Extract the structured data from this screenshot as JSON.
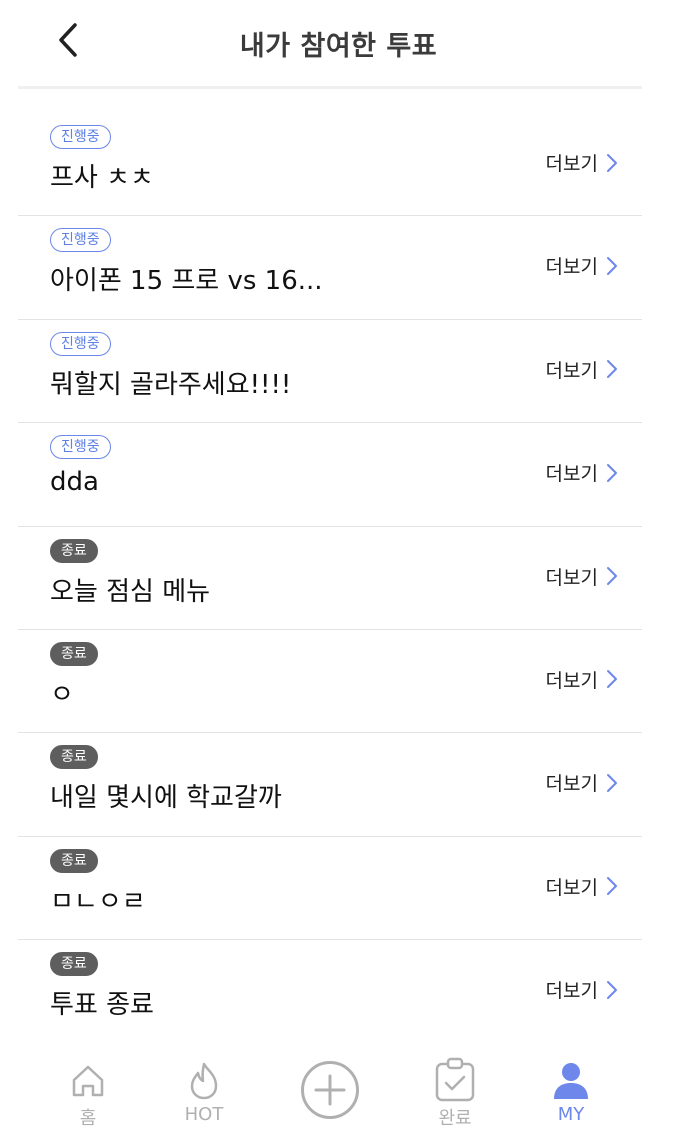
{
  "header": {
    "title": "내가 참여한 투표"
  },
  "more_label": "더보기",
  "votes": [
    {
      "status": "진행중",
      "title": "프사 ㅊㅊ"
    },
    {
      "status": "진행중",
      "title": "아이폰 15 프로 vs 16..."
    },
    {
      "status": "진행중",
      "title": "뭐할지 골라주세요!!!!"
    },
    {
      "status": "진행중",
      "title": "dda"
    },
    {
      "status": "종료",
      "title": "오늘 점심 메뉴"
    },
    {
      "status": "종료",
      "title": "ㅇ"
    },
    {
      "status": "종료",
      "title": "내일 몇시에 학교갈까"
    },
    {
      "status": "종료",
      "title": "ㅁㄴㅇㄹ"
    },
    {
      "status": "종료",
      "title": "투표 종료"
    }
  ],
  "tabbar": {
    "home": "홈",
    "hot": "HOT",
    "done": "완료",
    "my": "MY"
  },
  "colors": {
    "accent": "#6d87ea",
    "inactive": "#b0b0b0",
    "done_badge": "#5e5e5e"
  }
}
